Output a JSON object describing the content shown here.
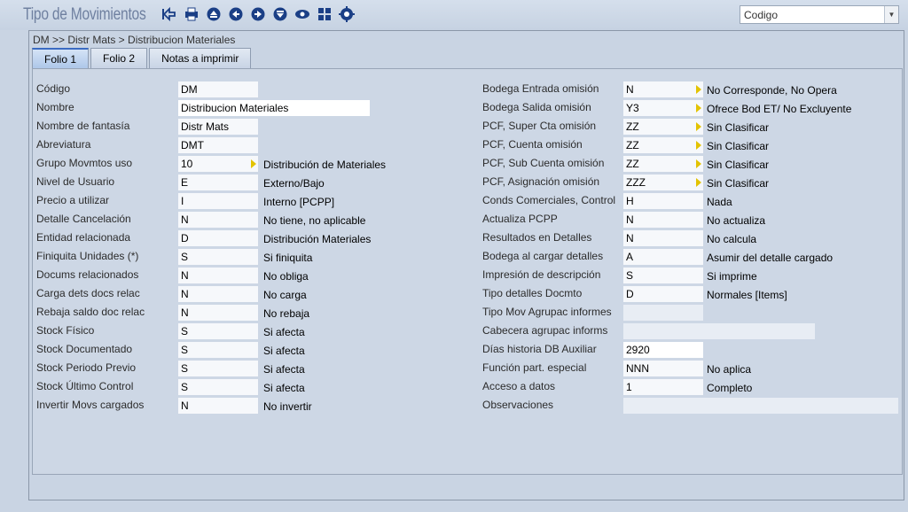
{
  "app": {
    "title": "Tipo de Movimientos",
    "breadcrumb": "DM >> Distr Mats > Distribucion Materiales",
    "order_select": "Codigo",
    "toolbar_icons": [
      "back-icon",
      "print-icon",
      "first-icon",
      "previous-icon",
      "next-icon",
      "last-icon",
      "view-icon",
      "grid-icon",
      "settings-icon"
    ]
  },
  "tabs": [
    {
      "label": "Folio 1",
      "active": true
    },
    {
      "label": "Folio 2",
      "active": false
    },
    {
      "label": "Notas a imprimir",
      "active": false
    }
  ],
  "left": [
    {
      "label": "Código",
      "value": "DM",
      "desc": ""
    },
    {
      "label": "Nombre",
      "value": "Distribucion Materiales",
      "desc": ""
    },
    {
      "label": "Nombre de fantasía",
      "value": "Distr Mats",
      "desc": ""
    },
    {
      "label": "Abreviatura",
      "value": "DMT",
      "desc": ""
    },
    {
      "label": "Grupo Movmtos uso",
      "value": "10",
      "desc": "Distribución de Materiales"
    },
    {
      "label": "Nivel de Usuario",
      "value": "E",
      "desc": "Externo/Bajo"
    },
    {
      "label": "Precio a utilizar",
      "value": "I",
      "desc": "Interno [PCPP]"
    },
    {
      "label": "Detalle Cancelación",
      "value": "N",
      "desc": "No tiene, no aplicable"
    },
    {
      "label": "Entidad relacionada",
      "value": "D",
      "desc": "Distribución Materiales"
    },
    {
      "label": "Finiquita Unidades (*)",
      "value": "S",
      "desc": "Si finiquita"
    },
    {
      "label": "Docums relacionados",
      "value": "N",
      "desc": "No obliga"
    },
    {
      "label": "Carga dets docs relac",
      "value": "N",
      "desc": "No carga"
    },
    {
      "label": "Rebaja saldo doc relac",
      "value": "N",
      "desc": "No rebaja"
    },
    {
      "label": "Stock Físico",
      "value": "S",
      "desc": "Si afecta"
    },
    {
      "label": "Stock Documentado",
      "value": "S",
      "desc": "Si afecta"
    },
    {
      "label": "Stock Periodo Previo",
      "value": "S",
      "desc": "Si afecta"
    },
    {
      "label": "Stock Último Control",
      "value": "S",
      "desc": "Si afecta"
    },
    {
      "label": "Invertir Movs cargados",
      "value": "N",
      "desc": "No invertir"
    }
  ],
  "right": [
    {
      "label": "Bodega Entrada omisión",
      "value": "N",
      "desc": "No Corresponde, No Opera"
    },
    {
      "label": "Bodega Salida omisión",
      "value": "Y3",
      "desc": "Ofrece Bod ET/ No Excluyente"
    },
    {
      "label": "PCF, Super Cta omisión",
      "value": "ZZ",
      "desc": "Sin Clasificar"
    },
    {
      "label": "PCF, Cuenta omisión",
      "value": "ZZ",
      "desc": "Sin Clasificar"
    },
    {
      "label": "PCF, Sub Cuenta omisión",
      "value": "ZZ",
      "desc": "Sin Clasificar"
    },
    {
      "label": "PCF, Asignación omisión",
      "value": "ZZZ",
      "desc": "Sin Clasificar"
    },
    {
      "label": "Conds Comerciales, Control",
      "value": "H",
      "desc": "Nada"
    },
    {
      "label": "Actualiza PCPP",
      "value": "N",
      "desc": "No actualiza"
    },
    {
      "label": "Resultados en Detalles",
      "value": "N",
      "desc": "No calcula"
    },
    {
      "label": "Bodega al cargar detalles",
      "value": "A",
      "desc": "Asumir del detalle cargado"
    },
    {
      "label": "Impresión de descripción",
      "value": "S",
      "desc": "Si imprime"
    },
    {
      "label": "Tipo detalles Docmto",
      "value": "D",
      "desc": "Normales [Items]"
    },
    {
      "label": "Tipo Mov Agrupac informes",
      "value": "",
      "desc": ""
    },
    {
      "label": "Cabecera agrupac informs",
      "value": "",
      "desc": ""
    },
    {
      "label": "Días historia DB Auxiliar",
      "value": "2920",
      "desc": ""
    },
    {
      "label": "Función part. especial",
      "value": "NNN",
      "desc": "No aplica"
    },
    {
      "label": "Acceso a datos",
      "value": "1",
      "desc": "Completo"
    },
    {
      "label": "Observaciones",
      "value": "",
      "desc": ""
    }
  ]
}
